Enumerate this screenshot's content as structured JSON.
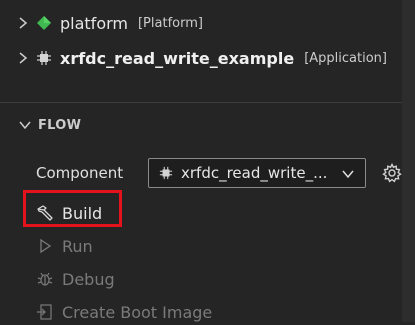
{
  "explorer": {
    "items": [
      {
        "label": "platform",
        "tag": "[Platform]",
        "icon": "platform-diamond-icon",
        "bold": false
      },
      {
        "label": "xrfdc_read_write_example",
        "tag": "[Application]",
        "icon": "chip-icon",
        "bold": true
      }
    ]
  },
  "flow": {
    "title": "FLOW",
    "component_label": "Component",
    "component_value": "xrfdc_read_write_...",
    "actions": {
      "build": "Build",
      "run": "Run",
      "debug": "Debug",
      "boot": "Create Boot Image"
    }
  },
  "colors": {
    "background": "#252526",
    "highlight_border": "#e3121b",
    "platform_icon": "#3fb950",
    "disabled_text": "#7a7a7a"
  }
}
